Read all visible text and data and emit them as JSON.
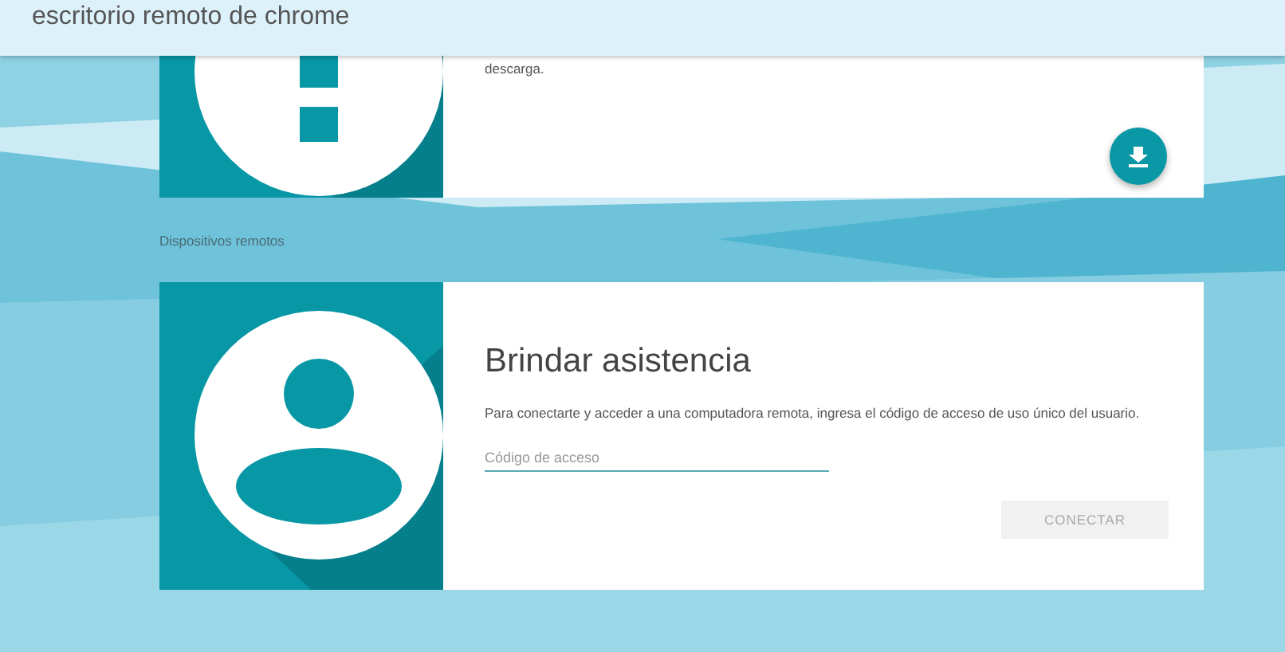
{
  "app_bar": {
    "title": "escritorio remoto de chrome"
  },
  "help_card": {
    "description": "descarga."
  },
  "section_label": "Dispositivos remotos",
  "support_card": {
    "title": "Brindar asistencia",
    "description": "Para conectarte y acceder a una computadora remota, ingresa el código de acceso de uso único del usuario.",
    "field": {
      "placeholder": "Código de acceso"
    },
    "button": {
      "label": "CONECTAR",
      "disabled": true
    }
  }
}
